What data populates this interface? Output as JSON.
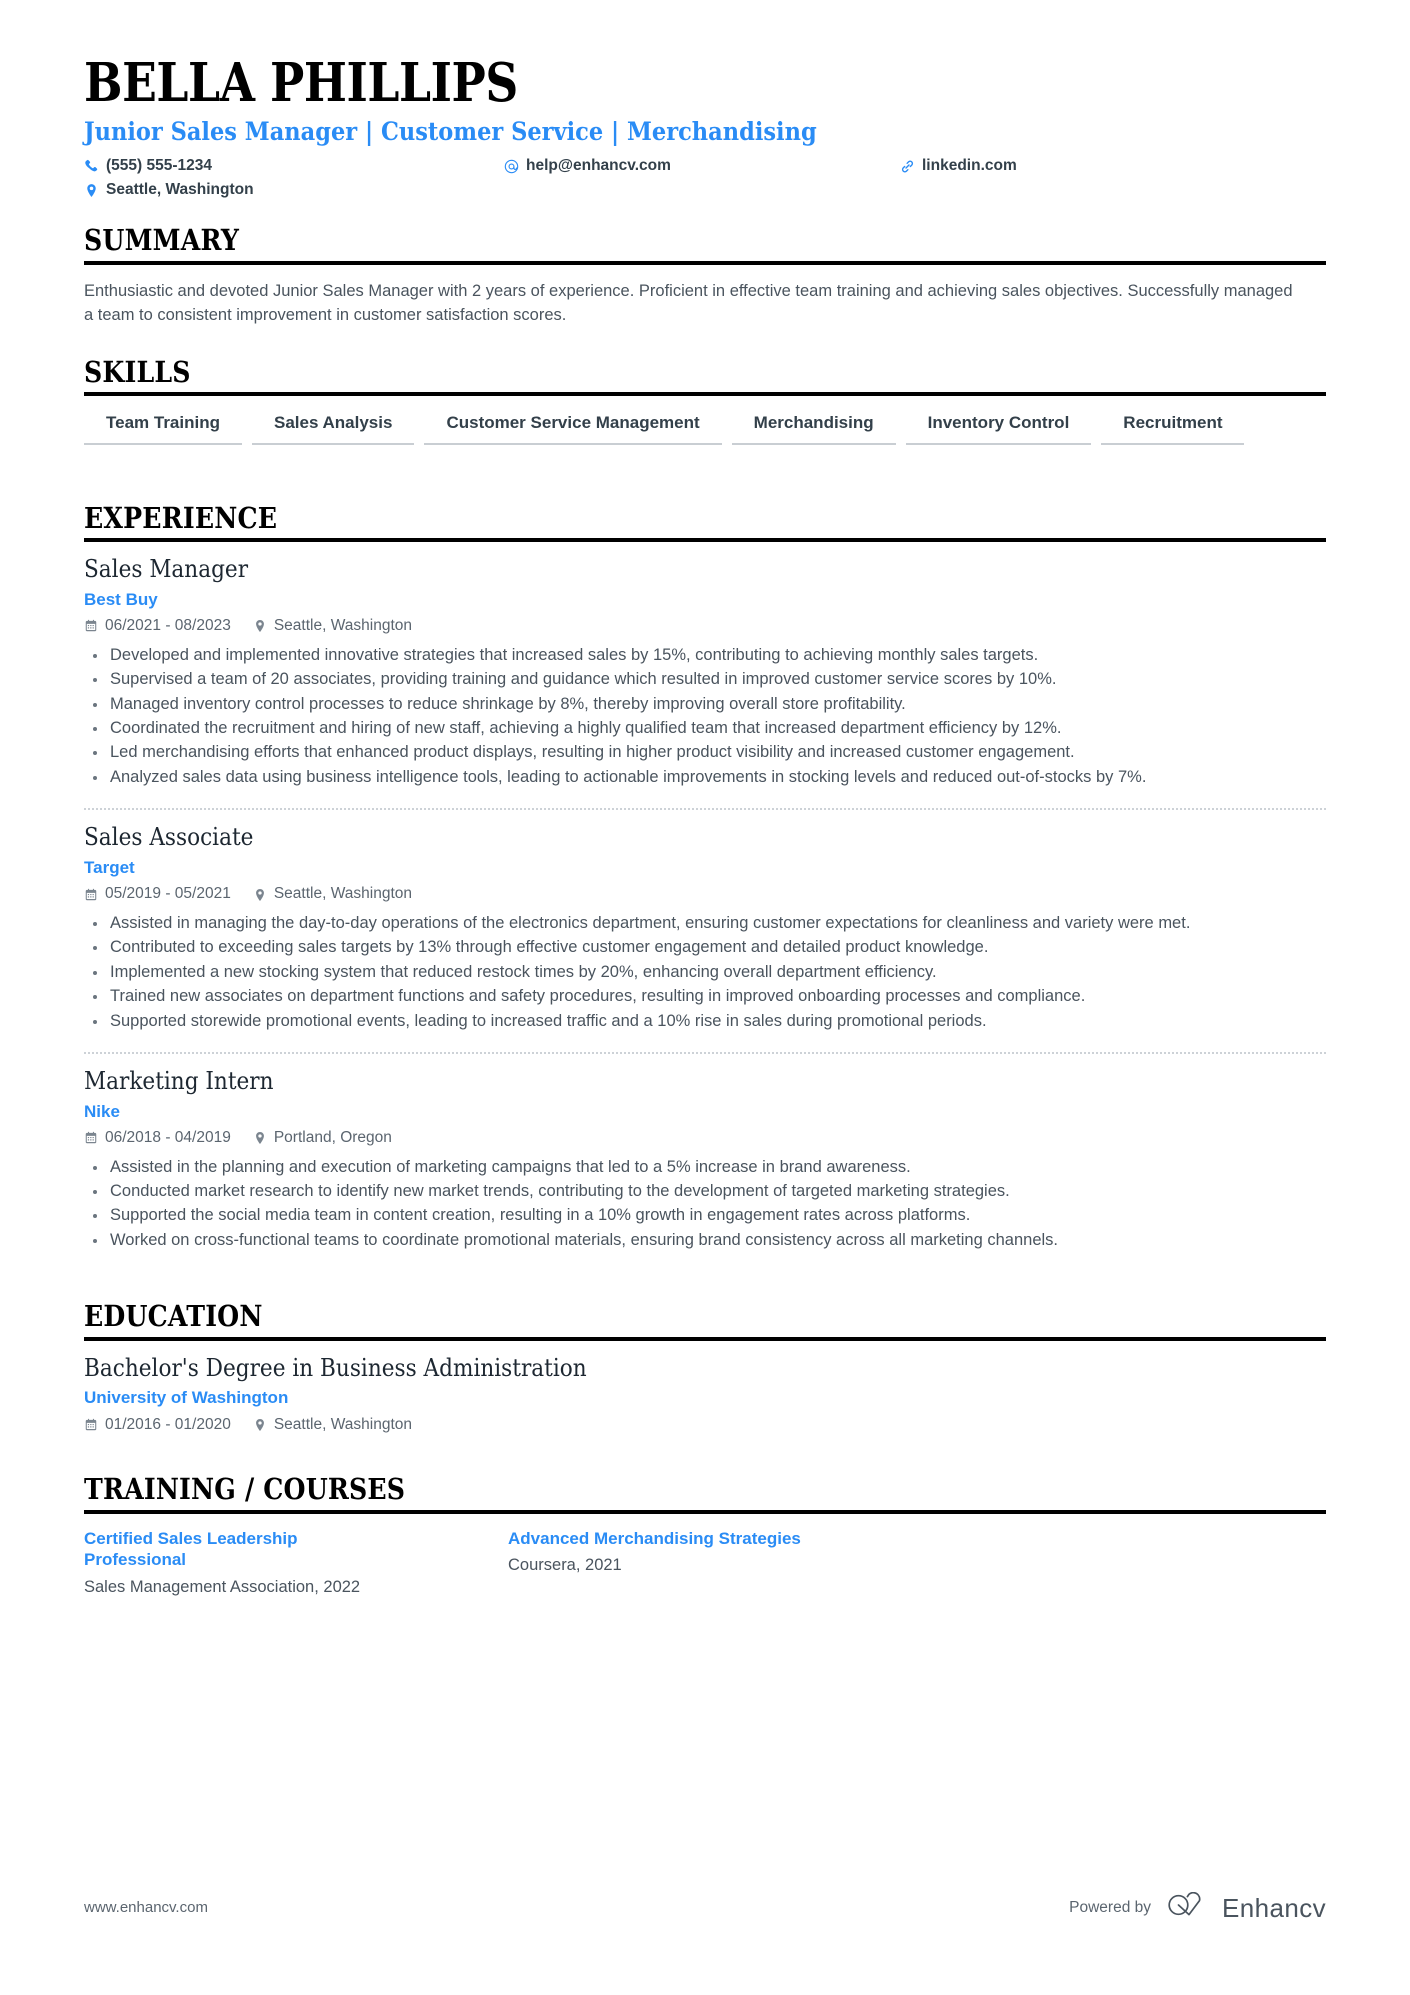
{
  "header": {
    "name": "BELLA PHILLIPS",
    "headline": "Junior Sales Manager | Customer Service | Merchandising",
    "contacts": [
      {
        "icon": "phone-icon",
        "text": "(555) 555-1234"
      },
      {
        "icon": "email-icon",
        "text": "help@enhancv.com"
      },
      {
        "icon": "link-icon",
        "text": "linkedin.com"
      },
      {
        "icon": "location-pin-icon",
        "text": "Seattle, Washington"
      }
    ]
  },
  "summary": {
    "title": "SUMMARY",
    "text": "Enthusiastic and devoted Junior Sales Manager with 2 years of experience. Proficient in effective team training and achieving sales objectives. Successfully managed a team to consistent improvement in customer satisfaction scores."
  },
  "skills": {
    "title": "SKILLS",
    "items": [
      "Team Training",
      "Sales Analysis",
      "Customer Service Management",
      "Merchandising",
      "Inventory Control",
      "Recruitment"
    ]
  },
  "experience": {
    "title": "EXPERIENCE",
    "jobs": [
      {
        "title": "Sales Manager",
        "company": "Best Buy",
        "dates": "06/2021 - 08/2023",
        "location": "Seattle, Washington",
        "bullets": [
          "Developed and implemented innovative strategies that increased sales by 15%, contributing to achieving monthly sales targets.",
          "Supervised a team of 20 associates, providing training and guidance which resulted in improved customer service scores by 10%.",
          "Managed inventory control processes to reduce shrinkage by 8%, thereby improving overall store profitability.",
          "Coordinated the recruitment and hiring of new staff, achieving a highly qualified team that increased department efficiency by 12%.",
          "Led merchandising efforts that enhanced product displays, resulting in higher product visibility and increased customer engagement.",
          "Analyzed sales data using business intelligence tools, leading to actionable improvements in stocking levels and reduced out-of-stocks by 7%."
        ]
      },
      {
        "title": "Sales Associate",
        "company": "Target",
        "dates": "05/2019 - 05/2021",
        "location": "Seattle, Washington",
        "bullets": [
          "Assisted in managing the day-to-day operations of the electronics department, ensuring customer expectations for cleanliness and variety were met.",
          "Contributed to exceeding sales targets by 13% through effective customer engagement and detailed product knowledge.",
          "Implemented a new stocking system that reduced restock times by 20%, enhancing overall department efficiency.",
          "Trained new associates on department functions and safety procedures, resulting in improved onboarding processes and compliance.",
          "Supported storewide promotional events, leading to increased traffic and a 10% rise in sales during promotional periods."
        ]
      },
      {
        "title": "Marketing Intern",
        "company": "Nike",
        "dates": "06/2018 - 04/2019",
        "location": "Portland, Oregon",
        "bullets": [
          "Assisted in the planning and execution of marketing campaigns that led to a 5% increase in brand awareness.",
          "Conducted market research to identify new market trends, contributing to the development of targeted marketing strategies.",
          "Supported the social media team in content creation, resulting in a 10% growth in engagement rates across platforms.",
          "Worked on cross-functional teams to coordinate promotional materials, ensuring brand consistency across all marketing channels."
        ]
      }
    ]
  },
  "education": {
    "title": "EDUCATION",
    "entries": [
      {
        "degree": "Bachelor's Degree in Business Administration",
        "school": "University of Washington",
        "dates": "01/2016 - 01/2020",
        "location": "Seattle, Washington"
      }
    ]
  },
  "training": {
    "title": "TRAINING / COURSES",
    "courses": [
      {
        "name": "Certified Sales Leadership Professional",
        "provider": "Sales Management Association, 2022"
      },
      {
        "name": "Advanced Merchandising Strategies",
        "provider": "Coursera, 2021"
      }
    ]
  },
  "footer": {
    "url": "www.enhancv.com",
    "powered_label": "Powered by",
    "brand": "Enhancv"
  },
  "colors": {
    "accent": "#2a8cf5",
    "text": "#4a545e",
    "heading": "#000000"
  }
}
